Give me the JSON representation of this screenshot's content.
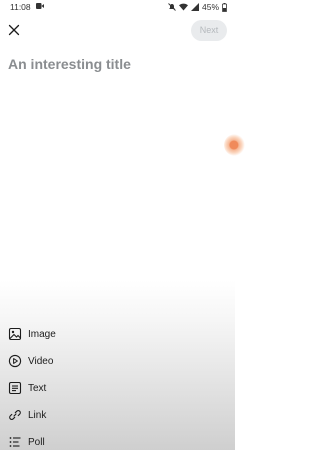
{
  "status_bar": {
    "time": "11:08",
    "battery": "45%"
  },
  "header": {
    "next_label": "Next"
  },
  "post": {
    "title_placeholder": "An interesting title"
  },
  "post_types": [
    {
      "label": "Image",
      "icon": "image-icon"
    },
    {
      "label": "Video",
      "icon": "video-icon"
    },
    {
      "label": "Text",
      "icon": "text-icon"
    },
    {
      "label": "Link",
      "icon": "link-icon"
    },
    {
      "label": "Poll",
      "icon": "poll-icon"
    }
  ],
  "colors": {
    "next_bg": "#e9ebed",
    "next_text": "#b5b9bd",
    "placeholder": "#8a8d90",
    "accent": "#f08a5a"
  }
}
